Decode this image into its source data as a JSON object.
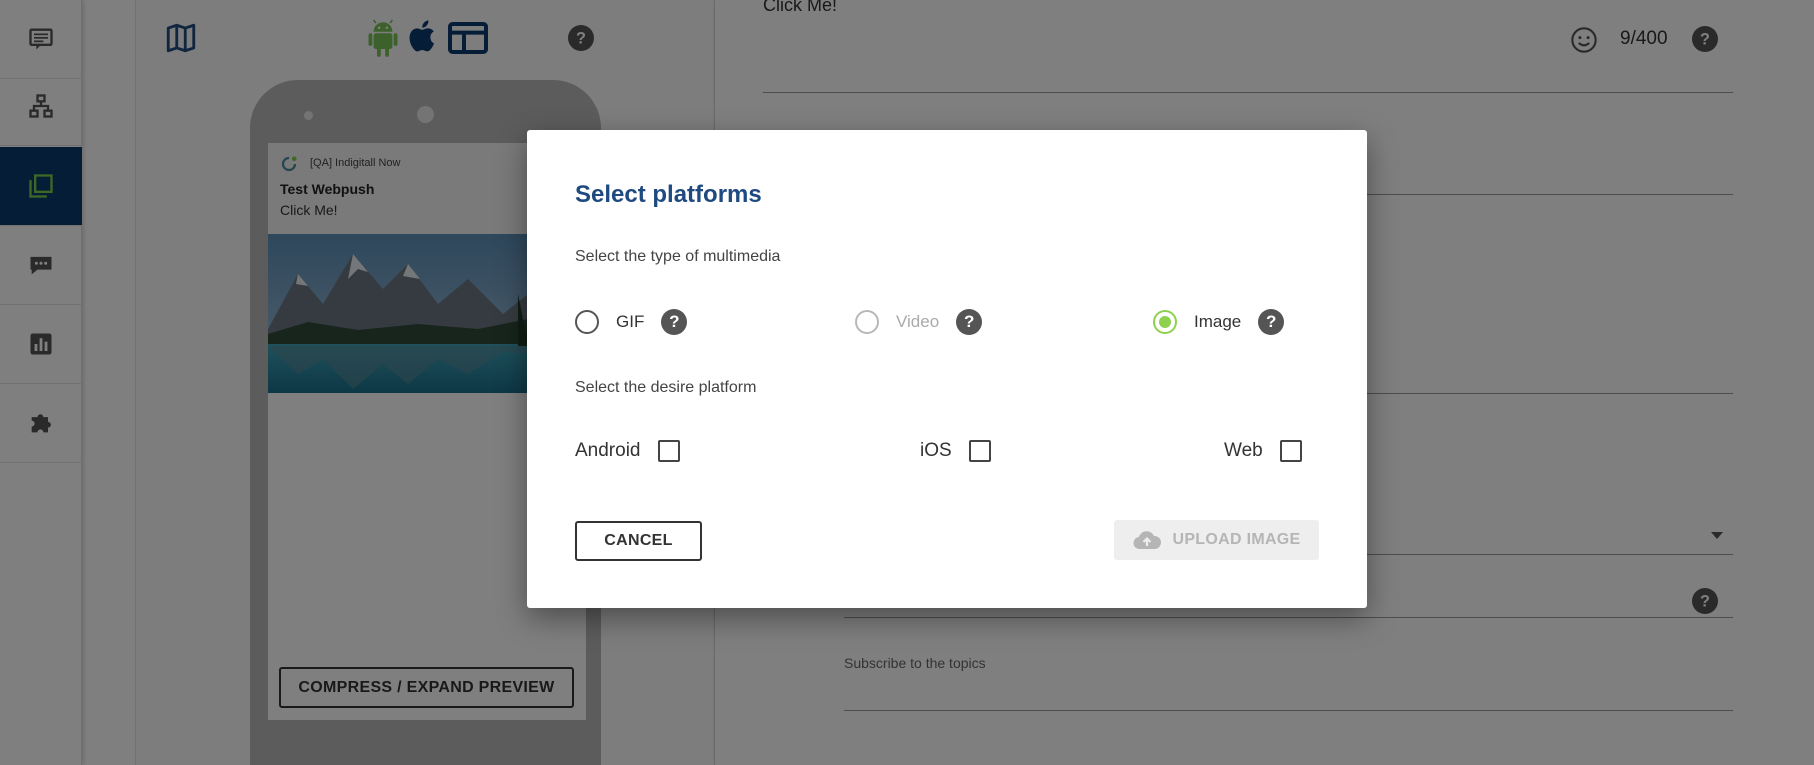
{
  "sidebar": {
    "items": [
      {
        "icon": "message-list-icon"
      },
      {
        "icon": "sitemap-icon"
      },
      {
        "icon": "campaigns-icon",
        "active": true
      },
      {
        "icon": "chat-icon"
      },
      {
        "icon": "analytics-icon"
      },
      {
        "icon": "puzzle-icon"
      }
    ]
  },
  "preview": {
    "notification": {
      "app_name": "[QA] Indigitall Now",
      "title": "Test Webpush",
      "body": "Click Me!"
    },
    "toggle_label": "COMPRESS / EXPAND PREVIEW"
  },
  "form": {
    "message_text": "Click Me!",
    "char_count": "9/400",
    "topics_label": "Subscribe to the topics"
  },
  "dialog": {
    "title": "Select platforms",
    "multimedia_label": "Select the type of multimedia",
    "media_options": [
      {
        "label": "GIF",
        "selected": false,
        "disabled": false
      },
      {
        "label": "Video",
        "selected": false,
        "disabled": true
      },
      {
        "label": "Image",
        "selected": true,
        "disabled": false
      }
    ],
    "platform_label": "Select the desire platform",
    "platforms": [
      {
        "label": "Android",
        "checked": false
      },
      {
        "label": "iOS",
        "checked": false
      },
      {
        "label": "Web",
        "checked": false
      }
    ],
    "cancel_label": "CANCEL",
    "upload_label": "UPLOAD IMAGE"
  },
  "colors": {
    "accent_dark": "#0d3a6e",
    "title_blue": "#1f4a80",
    "radio_green": "#8fd14f",
    "android_green": "#78c257",
    "overlay": "rgba(0,0,0,0.5)"
  }
}
